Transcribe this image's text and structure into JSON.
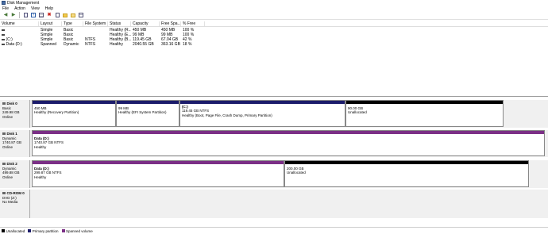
{
  "window": {
    "title": "Disk Management"
  },
  "menu": [
    "File",
    "Action",
    "View",
    "Help"
  ],
  "toolbar": [
    "back-icon",
    "forward-icon",
    "properties-icon",
    "help-icon",
    "disk-list-icon",
    "delete-icon",
    "properties-sheet-icon",
    "open-folder-icon",
    "explore-folder-icon",
    "volume-list-icon"
  ],
  "volumes": {
    "headers": [
      "Volume",
      "Layout",
      "Type",
      "File System",
      "Status",
      "Capacity",
      "Free Spa...",
      "% Free"
    ],
    "rows": [
      [
        "",
        "Simple",
        "Basic",
        "",
        "Healthy (R...",
        "450 MB",
        "450 MB",
        "100 %"
      ],
      [
        "",
        "Simple",
        "Basic",
        "",
        "Healthy (E...",
        "99 MB",
        "99 MB",
        "100 %"
      ],
      [
        "(C:)",
        "Simple",
        "Basic",
        "NTFS",
        "Healthy (B...",
        "119.45 GB",
        "67.04 GB",
        "42 %"
      ],
      [
        "Data (D:)",
        "Spanned",
        "Dynamic",
        "NTFS",
        "Healthy",
        "2040.55 GB",
        "363.16 GB",
        "18 %"
      ]
    ]
  },
  "disks": [
    {
      "name": "Disk 0",
      "type": "Basic",
      "size": "249.98 GB",
      "status": "Online",
      "partitions": [
        {
          "name": "",
          "line1": "450 MB",
          "line2": "Healthy (Recovery Partition)",
          "kind": "primary"
        },
        {
          "name": "",
          "line1": "99 MB",
          "line2": "Healthy (EFI System Partition)",
          "kind": "primary"
        },
        {
          "name": "(C:)",
          "line1": "119.45 GB NTFS",
          "line2": "Healthy (Boot, Page File, Crash Dump, Primary Partition)",
          "kind": "primary"
        },
        {
          "name": "",
          "line1": "90.00 GB",
          "line2": "Unallocated",
          "kind": "unalloc"
        }
      ]
    },
    {
      "name": "Disk 1",
      "type": "Dynamic",
      "size": "1740.87 GB",
      "status": "Online",
      "partitions": [
        {
          "name": "Data (D:)",
          "line1": "1740.87 GB NTFS",
          "line2": "Healthy",
          "kind": "spanned"
        }
      ]
    },
    {
      "name": "Disk 2",
      "type": "Dynamic",
      "size": "499.88 GB",
      "status": "Online",
      "partitions": [
        {
          "name": "Data (D:)",
          "line1": "299.87 GB NTFS",
          "line2": "Healthy",
          "kind": "spanned"
        },
        {
          "name": "",
          "line1": "200.00 GB",
          "line2": "Unallocated",
          "kind": "unalloc"
        }
      ]
    },
    {
      "name": "CD-ROM 0",
      "type": "DVD (Z:)",
      "size": "",
      "status": "No Media",
      "partitions": []
    }
  ],
  "legend": [
    {
      "label": "Unallocated",
      "color": "#000000"
    },
    {
      "label": "Primary partition",
      "color": "#1c1c6b"
    },
    {
      "label": "Spanned volume",
      "color": "#7b2f86"
    }
  ]
}
